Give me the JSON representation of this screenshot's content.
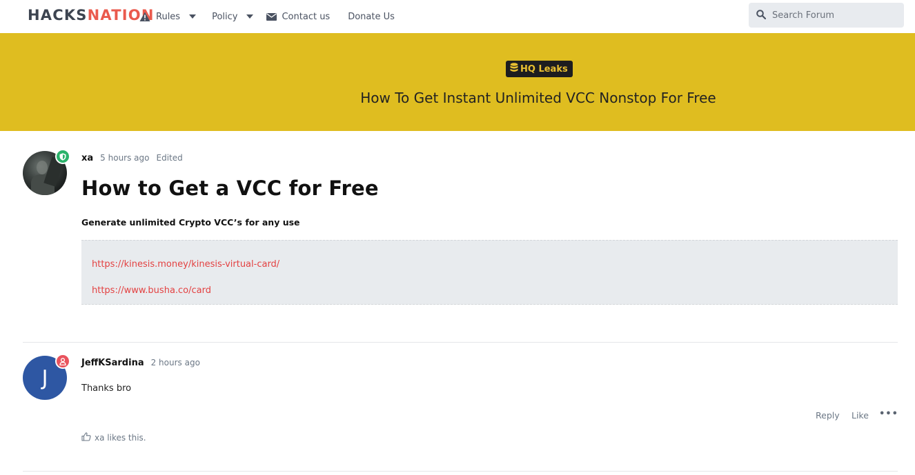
{
  "header": {
    "logo_part1": "HACKS",
    "logo_part2": "NATION",
    "nav": [
      {
        "label": "Rules",
        "icon": "warning-icon",
        "has_dropdown": true
      },
      {
        "label": "Policy",
        "icon": "",
        "has_dropdown": true
      },
      {
        "label": "Contact us",
        "icon": "envelope-icon",
        "has_dropdown": false
      },
      {
        "label": "Donate Us",
        "icon": "",
        "has_dropdown": false
      }
    ],
    "search_placeholder": "Search Forum"
  },
  "banner": {
    "category": "HQ Leaks",
    "category_icon": "database-icon",
    "title": "How To Get Instant Unlimited VCC Nonstop For Free"
  },
  "posts": [
    {
      "username": "xa",
      "time": "5 hours ago",
      "edited": "Edited",
      "status_icon": "shield-icon",
      "title": "How to Get a VCC for Free",
      "subtitle": "Generate unlimited Crypto VCC’s for any use",
      "links": [
        "https://kinesis.money/kinesis-virtual-card/",
        "https://www.busha.co/card"
      ]
    },
    {
      "username": "JeffKSardina",
      "avatar_letter": "J",
      "time": "2 hours ago",
      "status_icon": "user-icon",
      "text": "Thanks bro",
      "actions": {
        "reply": "Reply",
        "like": "Like",
        "more": "•••"
      },
      "likes_text": "xa likes this."
    }
  ],
  "colors": {
    "banner": "#dfbd20",
    "logo_accent": "#ea5a4d",
    "link": "#e34141",
    "online_green": "#2ab26a",
    "avatar_blue": "#2e57a3"
  }
}
